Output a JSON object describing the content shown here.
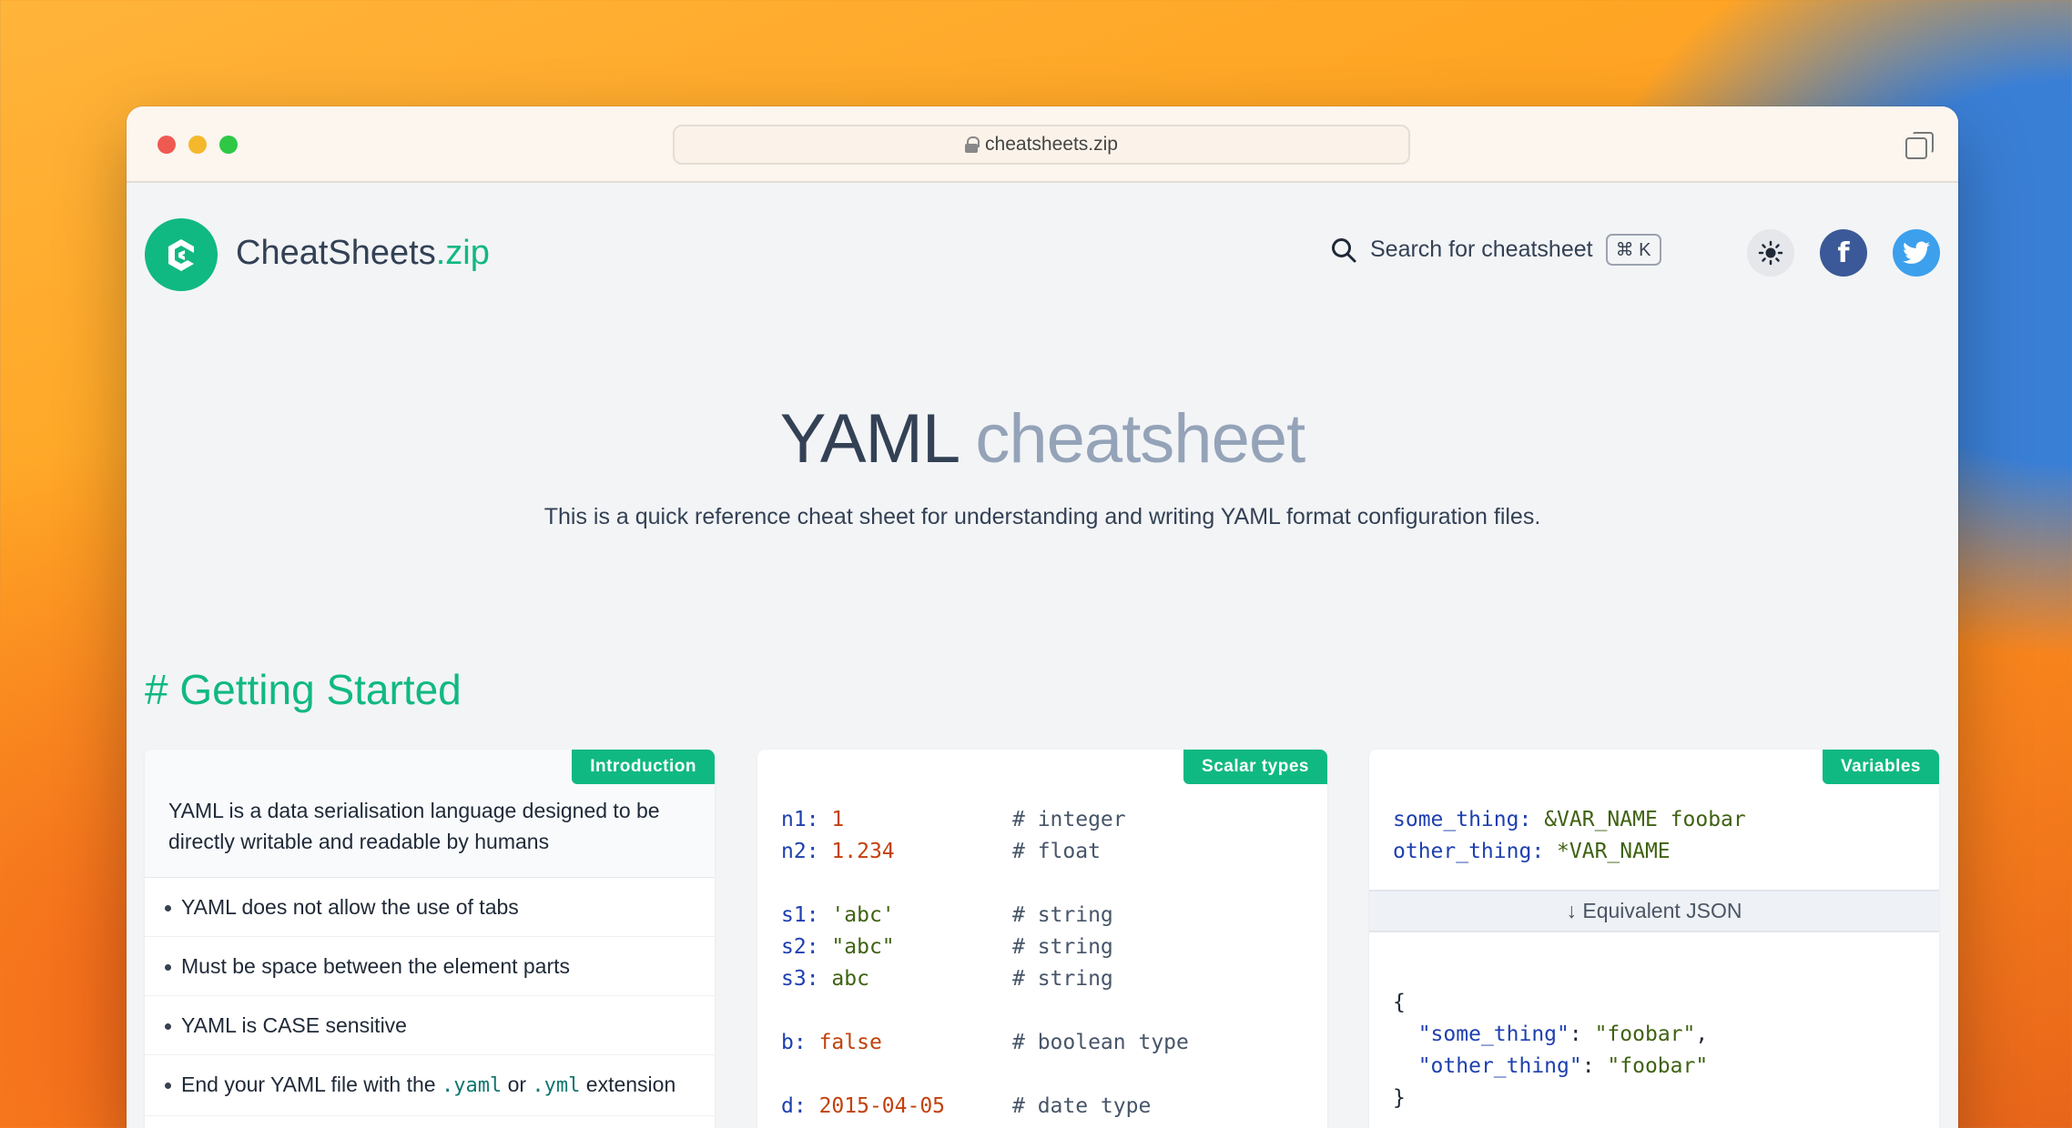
{
  "browser": {
    "url": "cheatsheets.zip"
  },
  "header": {
    "logo_main": "CheatSheets",
    "logo_suffix": ".zip",
    "search_label": "Search for cheatsheet",
    "search_shortcut": "⌘ K",
    "facebook_glyph": "f"
  },
  "hero": {
    "title_main": "YAML",
    "title_light": "cheatsheet",
    "description": "This is a quick reference cheat sheet for understanding and writing YAML format configuration files."
  },
  "section": {
    "title": "# Getting Started"
  },
  "cards": {
    "intro": {
      "badge": "Introduction",
      "text": "YAML is a data serialisation language designed to be directly writable and readable by humans",
      "bullets": [
        "YAML does not allow the use of tabs",
        "Must be space between the element parts",
        "YAML is CASE sensitive"
      ],
      "last_bullet_pre": "End your YAML file with the",
      "last_bullet_code1": ".yaml",
      "last_bullet_mid": "or",
      "last_bullet_code2": ".yml",
      "last_bullet_post": "extension"
    },
    "scalar": {
      "badge": "Scalar types",
      "lines": [
        {
          "key": "n1:",
          "val": "1",
          "type": "n",
          "comment": "# integer"
        },
        {
          "key": "n2:",
          "val": "1.234",
          "type": "n",
          "comment": "# float"
        },
        {
          "key": "",
          "val": "",
          "type": "",
          "comment": ""
        },
        {
          "key": "s1:",
          "val": "'abc'",
          "type": "s",
          "comment": "# string"
        },
        {
          "key": "s2:",
          "val": "\"abc\"",
          "type": "s",
          "comment": "# string"
        },
        {
          "key": "s3:",
          "val": "abc",
          "type": "s",
          "comment": "# string"
        },
        {
          "key": "",
          "val": "",
          "type": "",
          "comment": ""
        },
        {
          "key": "b:",
          "val": "false",
          "type": "n",
          "comment": "# boolean type"
        },
        {
          "key": "",
          "val": "",
          "type": "",
          "comment": ""
        },
        {
          "key": "d:",
          "val": "2015-04-05",
          "type": "n",
          "comment": "# date type"
        }
      ]
    },
    "variables": {
      "badge": "Variables",
      "line1_key": "some_thing:",
      "line1_val": "&VAR_NAME foobar",
      "line2_key": "other_thing:",
      "line2_val": "*VAR_NAME",
      "json_label": "↓ Equivalent JSON",
      "json_open": "{",
      "json_k1": "\"some_thing\"",
      "json_v1": "\"foobar\"",
      "json_k2": "\"other_thing\"",
      "json_v2": "\"foobar\"",
      "json_close": "}"
    }
  }
}
